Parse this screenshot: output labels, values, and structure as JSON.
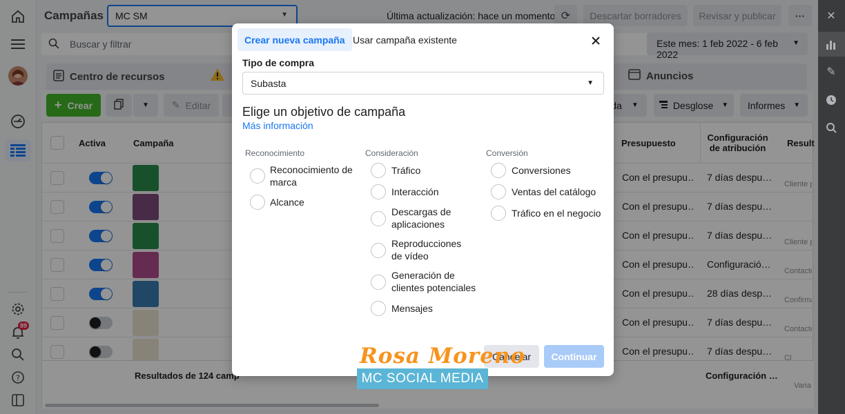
{
  "app": {
    "title": "Campañas",
    "account": "MC SM",
    "last_update": "Última actualización: hace un momento",
    "discard": "Descartar borradores",
    "review": "Revisar y publicar",
    "more": "···"
  },
  "search": {
    "placeholder": "Buscar y filtrar",
    "date_range": "Este mes: 1 feb 2022 - 6 feb 2022"
  },
  "tabs": {
    "resources": "Centro de recursos",
    "ads": "Anuncios"
  },
  "toolbar": {
    "create": "Crear",
    "edit": "Editar",
    "breakdown": "Desglose",
    "reports": "Informes",
    "partial": "da"
  },
  "table": {
    "headers": {
      "active": "Activa",
      "campaign": "Campaña",
      "budget": "Presupuesto",
      "attribution": "Configuración de atribución",
      "results": "Result"
    },
    "rows": [
      {
        "on": true,
        "budget": "Con el presupu…",
        "attribution": "7 días despu…",
        "result": "Cliente p"
      },
      {
        "on": true,
        "budget": "Con el presupu…",
        "attribution": "7 días despu…",
        "result": ""
      },
      {
        "on": true,
        "budget": "Con el presupu…",
        "attribution": "7 días despu…",
        "result": "Cliente p"
      },
      {
        "on": true,
        "budget": "Con el presupu…",
        "attribution": "Configuració…",
        "result": "Contacto"
      },
      {
        "on": true,
        "budget": "Con el presupu…",
        "attribution": "28 días desp…",
        "result": "Confirma"
      },
      {
        "on": false,
        "budget": "Con el presupu…",
        "attribution": "7 días despu…",
        "result": "Contacto"
      },
      {
        "on": false,
        "budget": "Con el presupu…",
        "attribution": "7 días despu…",
        "result": "Cl"
      }
    ],
    "footer": {
      "results": "Resultados de 124 camp",
      "attribution": "Configuración …",
      "variable": "Varia"
    }
  },
  "notifications": {
    "count": "89"
  },
  "modal": {
    "tab_new": "Crear nueva campaña",
    "tab_existing": "Usar campaña existente",
    "purchase_label": "Tipo de compra",
    "purchase_value": "Subasta",
    "objective_title": "Elige un objetivo de campaña",
    "more_info": "Más información",
    "columns": [
      {
        "title": "Reconocimiento",
        "options": [
          "Reconocimiento de marca",
          "Alcance"
        ]
      },
      {
        "title": "Consideración",
        "options": [
          "Tráfico",
          "Interacción",
          "Descargas de aplicaciones",
          "Reproducciones de vídeo",
          "Generación de clientes potenciales",
          "Mensajes"
        ]
      },
      {
        "title": "Conversión",
        "options": [
          "Conversiones",
          "Ventas del catálogo",
          "Tráfico en el negocio"
        ]
      }
    ],
    "cancel": "Cancelar",
    "continue": "Continuar"
  },
  "watermark": {
    "line1": "Rosa Moreno",
    "line2": "MC SOCIAL MEDIA"
  },
  "colors": {
    "accent": "#1877f2",
    "green": "#42b72a",
    "orange": "#f7931e",
    "teal": "#5bb5d6"
  }
}
